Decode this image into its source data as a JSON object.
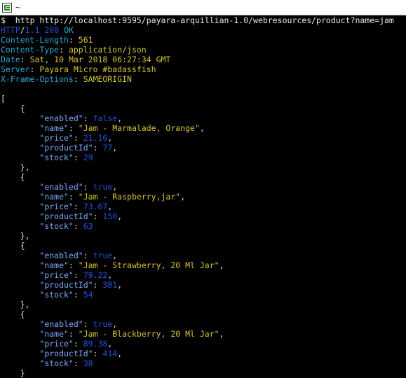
{
  "window": {
    "title": "~"
  },
  "prompt": {
    "symbol": "$",
    "command": "http http://localhost:9595/payara-arquillian-1.0/webresources/product?name=jam"
  },
  "status_line": {
    "protocol": "HTTP",
    "slash": "/",
    "version": "1.1",
    "code": "200",
    "reason": "OK"
  },
  "headers": [
    {
      "name": "Content-Length",
      "value": "561"
    },
    {
      "name": "Content-Type",
      "value": "application/json"
    },
    {
      "name": "Date",
      "value": "Sat, 10 Mar 2018 06:27:34 GMT"
    },
    {
      "name": "Server",
      "value": "Payara Micro #badassfish"
    },
    {
      "name": "X-Frame-Options",
      "value": "SAMEORIGIN"
    }
  ],
  "json_body": {
    "open_bracket": "[",
    "products": [
      {
        "enabled": "false",
        "name": "\"Jam - Marmalade, Orange\"",
        "price": "21.16",
        "productId": "77",
        "stock": "29"
      },
      {
        "enabled": "true",
        "name": "\"Jam - Raspberry,jar\"",
        "price": "73.67",
        "productId": "150",
        "stock": "63"
      },
      {
        "enabled": "true",
        "name": "\"Jam - Strawberry, 20 Ml Jar\"",
        "price": "79.22",
        "productId": "381",
        "stock": "54"
      },
      {
        "enabled": "true",
        "name": "\"Jam - Blackberry, 20 Ml Jar\"",
        "price": "89.38",
        "productId": "414",
        "stock": "38"
      }
    ]
  },
  "colors": {
    "background": "#000000",
    "http_token": "#2050d8",
    "header_name": "#2aa9d6",
    "header_value": "#d6c434",
    "json_key": "#7fa8ff",
    "json_value": "#2050d8"
  }
}
